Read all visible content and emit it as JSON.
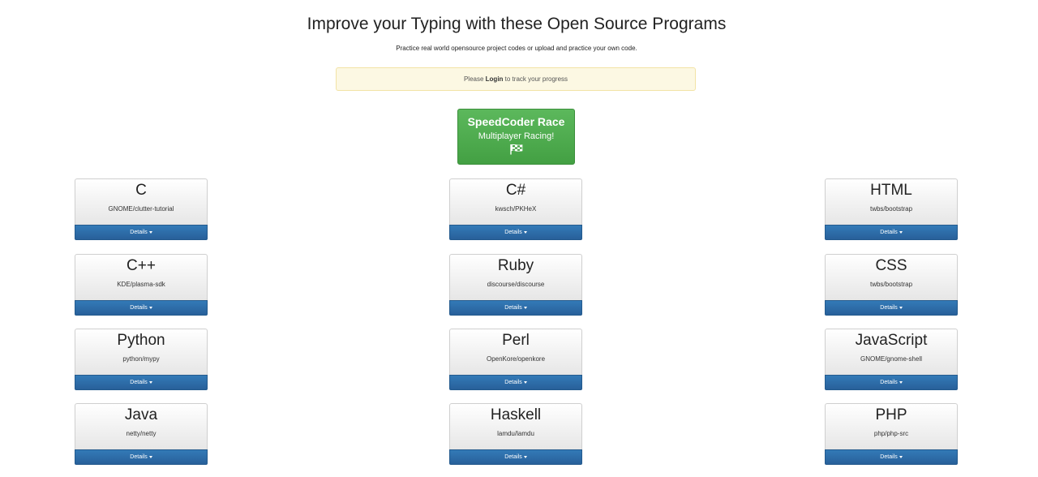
{
  "header": {
    "title": "Improve your Typing with these Open Source Programs",
    "subtitle": "Practice real world opensource project codes or upload and practice your own code."
  },
  "alert": {
    "prefix": "Please ",
    "login_label": "Login",
    "suffix": " to track your progress"
  },
  "race": {
    "title": "SpeedCoder Race",
    "subtitle": "Multiplayer Racing!",
    "icon": "checkered-flag-icon"
  },
  "details_label": "Details",
  "languages": [
    {
      "name": "C",
      "repo": "GNOME/clutter-tutorial"
    },
    {
      "name": "C#",
      "repo": "kwsch/PKHeX"
    },
    {
      "name": "HTML",
      "repo": "twbs/bootstrap"
    },
    {
      "name": "C++",
      "repo": "KDE/plasma-sdk"
    },
    {
      "name": "Ruby",
      "repo": "discourse/discourse"
    },
    {
      "name": "CSS",
      "repo": "twbs/bootstrap"
    },
    {
      "name": "Python",
      "repo": "python/mypy"
    },
    {
      "name": "Perl",
      "repo": "OpenKore/openkore"
    },
    {
      "name": "JavaScript",
      "repo": "GNOME/gnome-shell"
    },
    {
      "name": "Java",
      "repo": "netty/netty"
    },
    {
      "name": "Haskell",
      "repo": "lamdu/lamdu"
    },
    {
      "name": "PHP",
      "repo": "php/php-src"
    }
  ],
  "colors": {
    "race_green": "#5cb85c",
    "details_blue": "#337ab7",
    "alert_bg": "#fcf8e3"
  }
}
